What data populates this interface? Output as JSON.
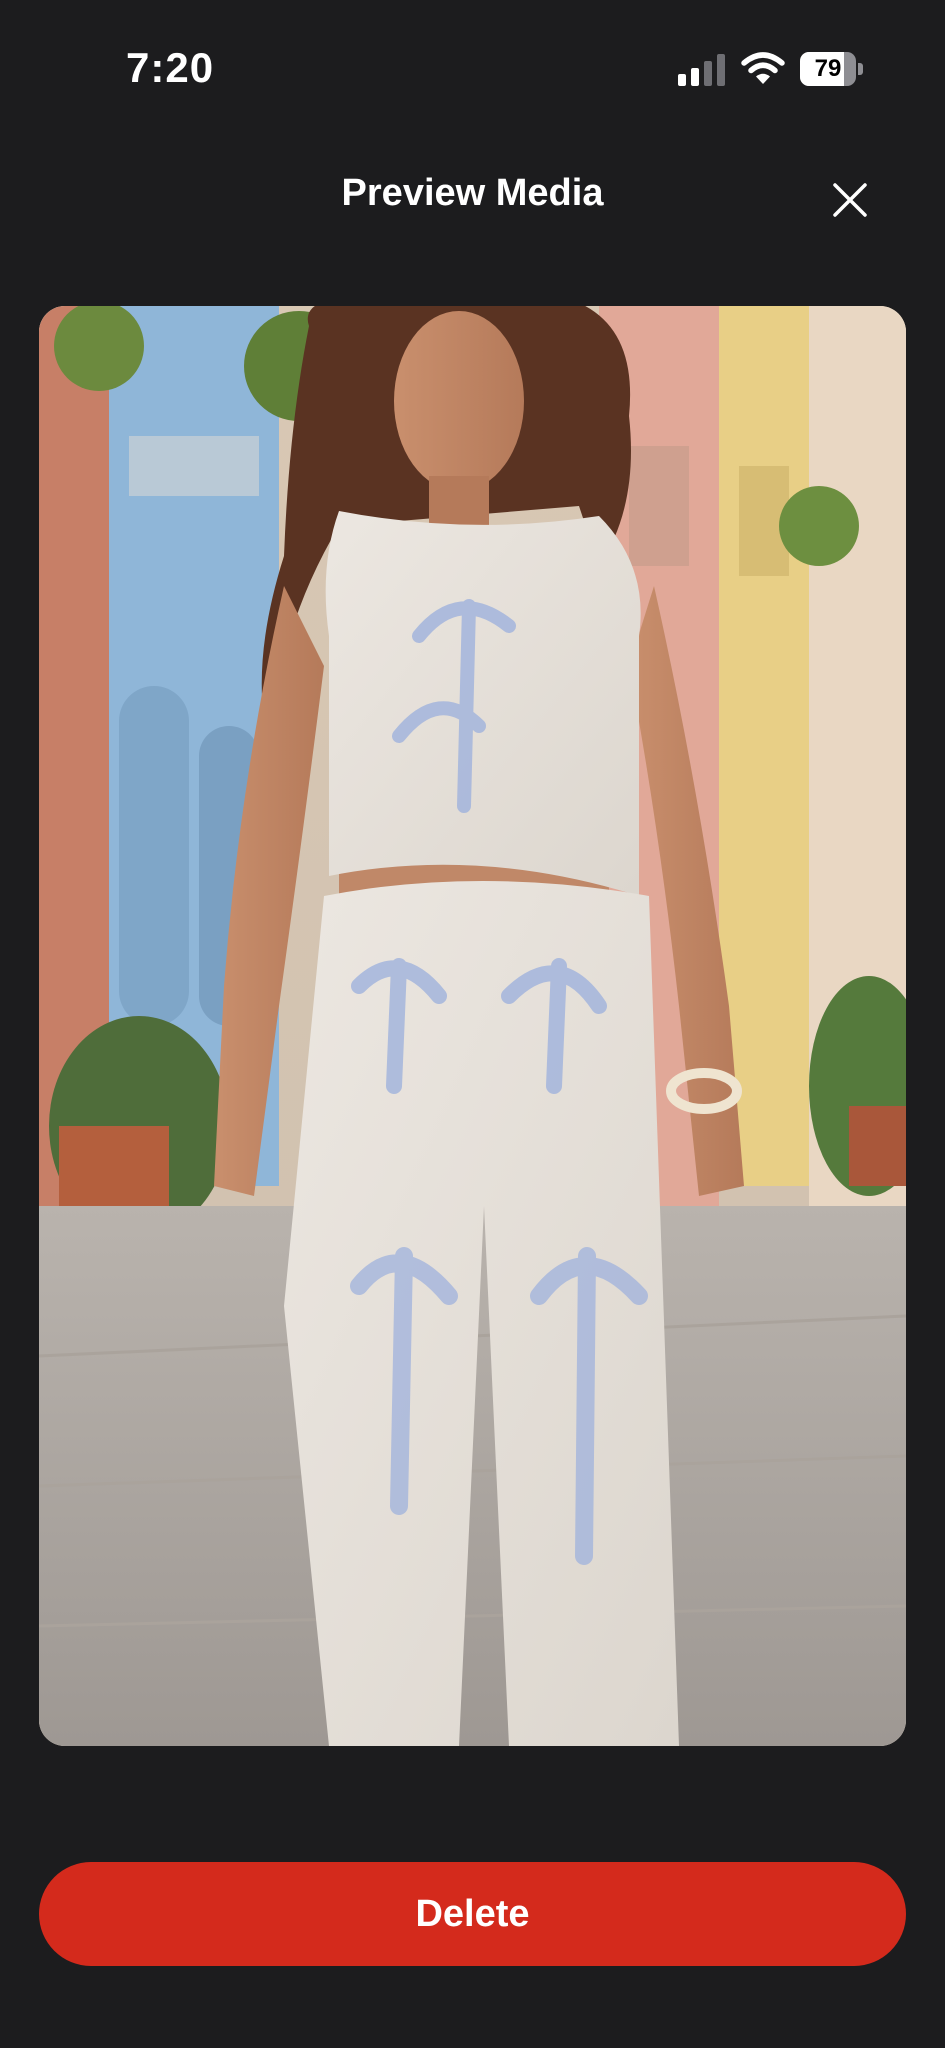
{
  "status_bar": {
    "time": "7:20",
    "battery_percent": "79",
    "battery_level": 0.79
  },
  "header": {
    "title": "Preview Media"
  },
  "preview": {
    "alt": "Woman in blue palm-print sleeveless crop top and wide-leg pants on a colorful street"
  },
  "actions": {
    "delete_label": "Delete"
  },
  "colors": {
    "background": "#1c1c1e",
    "delete": "#d42a1c"
  }
}
